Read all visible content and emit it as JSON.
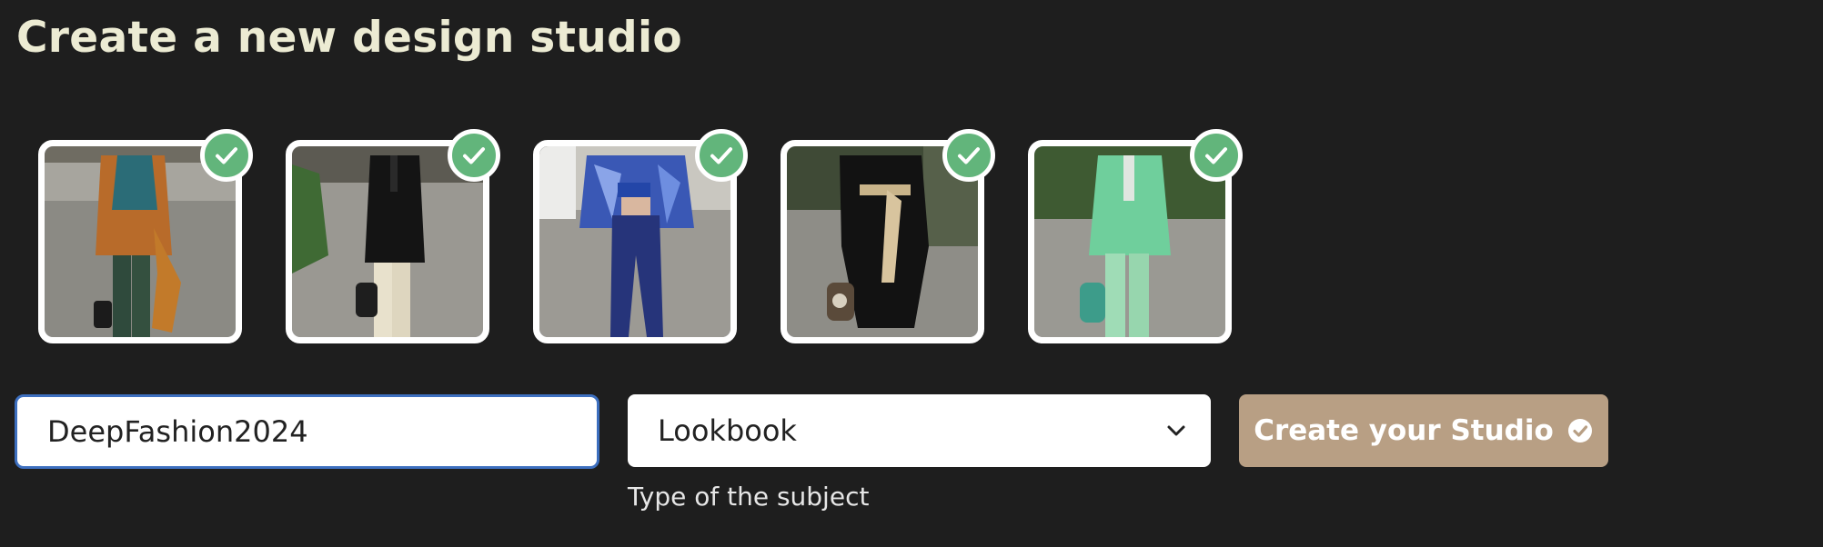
{
  "page": {
    "title": "Create a new design studio"
  },
  "thumbnails": [
    {
      "subject": "Model in orange patterned blouse and green trousers with scarf and handbag",
      "selected": true
    },
    {
      "subject": "Model in black blazer and cream trousers with black handbag",
      "selected": true
    },
    {
      "subject": "Model in blue floral jacket, crop top and navy satin trousers",
      "selected": true
    },
    {
      "subject": "Model in black wrap dress with printed scarf belt and bag",
      "selected": true
    },
    {
      "subject": "Model in mint green suit with teal bag",
      "selected": true
    }
  ],
  "form": {
    "studio_name_value": "DeepFashion2024",
    "subject_type_value": "Lookbook",
    "subject_type_helper": "Type of the subject",
    "create_button_label": "Create your Studio"
  },
  "icons": {
    "selected_check": "check-icon",
    "select_caret": "chevron-down-icon",
    "button_icon": "check-circle-icon"
  },
  "colors": {
    "background": "#1e1e1e",
    "title": "#ecebd3",
    "check_green": "#62b57b",
    "input_border_focus": "#3d6fbf",
    "button_tan": "#b89f84"
  }
}
